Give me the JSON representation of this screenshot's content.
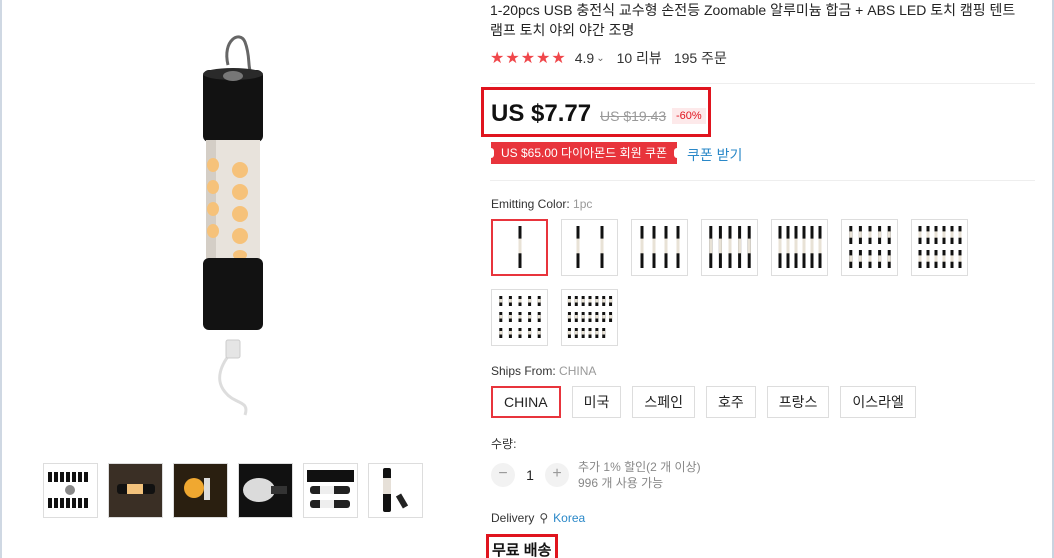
{
  "product": {
    "title_line1": "1-20pcs USB 충전식 교수형 손전등 Zoomable 알루미늄 합금 + ABS LED 토치 캠핑 텐트",
    "title_line2": "램프 토치 야외 야간 조명",
    "stars": "★★★★★",
    "rating": "4.9",
    "reviews": "10 리뷰",
    "orders": "195 주문"
  },
  "price": {
    "current": "US $7.77",
    "original": "US $19.43",
    "discount": "-60%"
  },
  "coupon": {
    "label": "US $65.00 다이아몬드 회원 쿠폰",
    "link": "쿠폰 받기"
  },
  "emitting_color": {
    "label": "Emitting Color:",
    "selected": "1pc",
    "variant_counts": [
      1,
      2,
      4,
      5,
      6,
      10,
      12,
      15,
      20
    ]
  },
  "ships_from": {
    "label": "Ships From:",
    "selected": "CHINA",
    "options": [
      "CHINA",
      "미국",
      "스페인",
      "호주",
      "프랑스",
      "이스라엘"
    ]
  },
  "quantity": {
    "label": "수량:",
    "value": "1",
    "minus": "−",
    "plus": "+",
    "note_line1": "추가 1% 할인(2 개 이상)",
    "note_line2": "996 개 사용 가능"
  },
  "delivery": {
    "label": "Delivery",
    "location": "Korea",
    "free_shipping": "무료 배송"
  },
  "colors": {
    "accent": "#e8343c",
    "highlight_box": "#e0141e",
    "link": "#2a88c8",
    "star": "#f0474b"
  }
}
